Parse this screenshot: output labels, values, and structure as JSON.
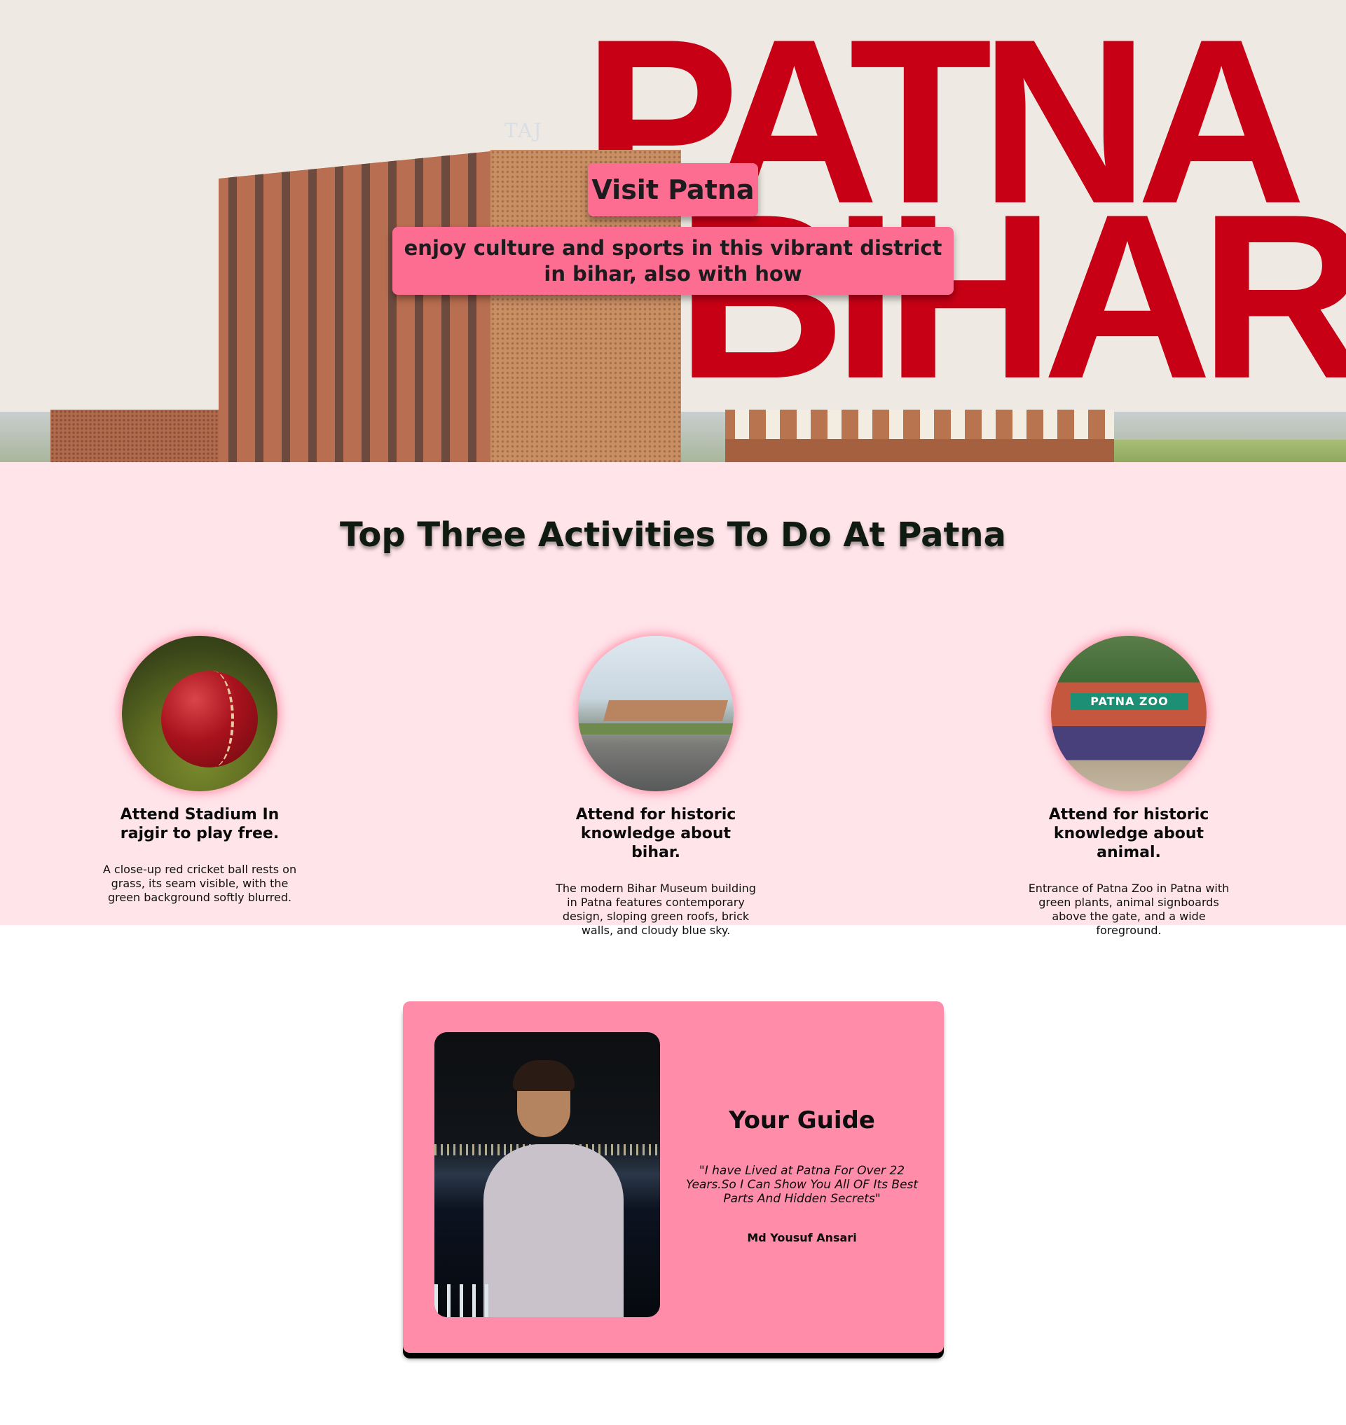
{
  "hero": {
    "big_word_1": "PATNA",
    "big_word_2": "BIHAR",
    "building_sign": "TAJ",
    "title": "Visit Patna",
    "subtitle": "enjoy culture and sports in this vibrant district in bihar, also with how"
  },
  "activities": {
    "title": "Top Three Activities To Do At Patna",
    "items": [
      {
        "heading": "Attend Stadium In rajgir to play free.",
        "description": "A close-up red cricket ball rests on grass, its seam visible, with the green background softly blurred.",
        "image": "cricket-ball-photo"
      },
      {
        "heading": "Attend for historic knowledge about bihar.",
        "description": "The modern Bihar Museum building in Patna features contemporary design, sloping green roofs, brick walls, and cloudy blue sky.",
        "image": "bihar-museum-photo"
      },
      {
        "heading": "Attend for historic knowledge about animal.",
        "description": "Entrance of Patna Zoo in Patna with green plants, animal signboards above the gate, and a wide foreground.",
        "image": "patna-zoo-photo",
        "sign_text": "PATNA ZOO"
      }
    ]
  },
  "guide": {
    "title": "Your Guide",
    "quote": "\"I have Lived at Patna For Over 22 Years.So I Can Show You All OF Its Best Parts And Hidden Secrets\"",
    "name": "Md Yousuf Ansari",
    "image": "guide-portrait-photo"
  },
  "colors": {
    "brand_red": "#c80015",
    "chip_pink": "#fc6d91",
    "section_bg": "#ffe4ea",
    "card_pink": "#ff8daa"
  }
}
